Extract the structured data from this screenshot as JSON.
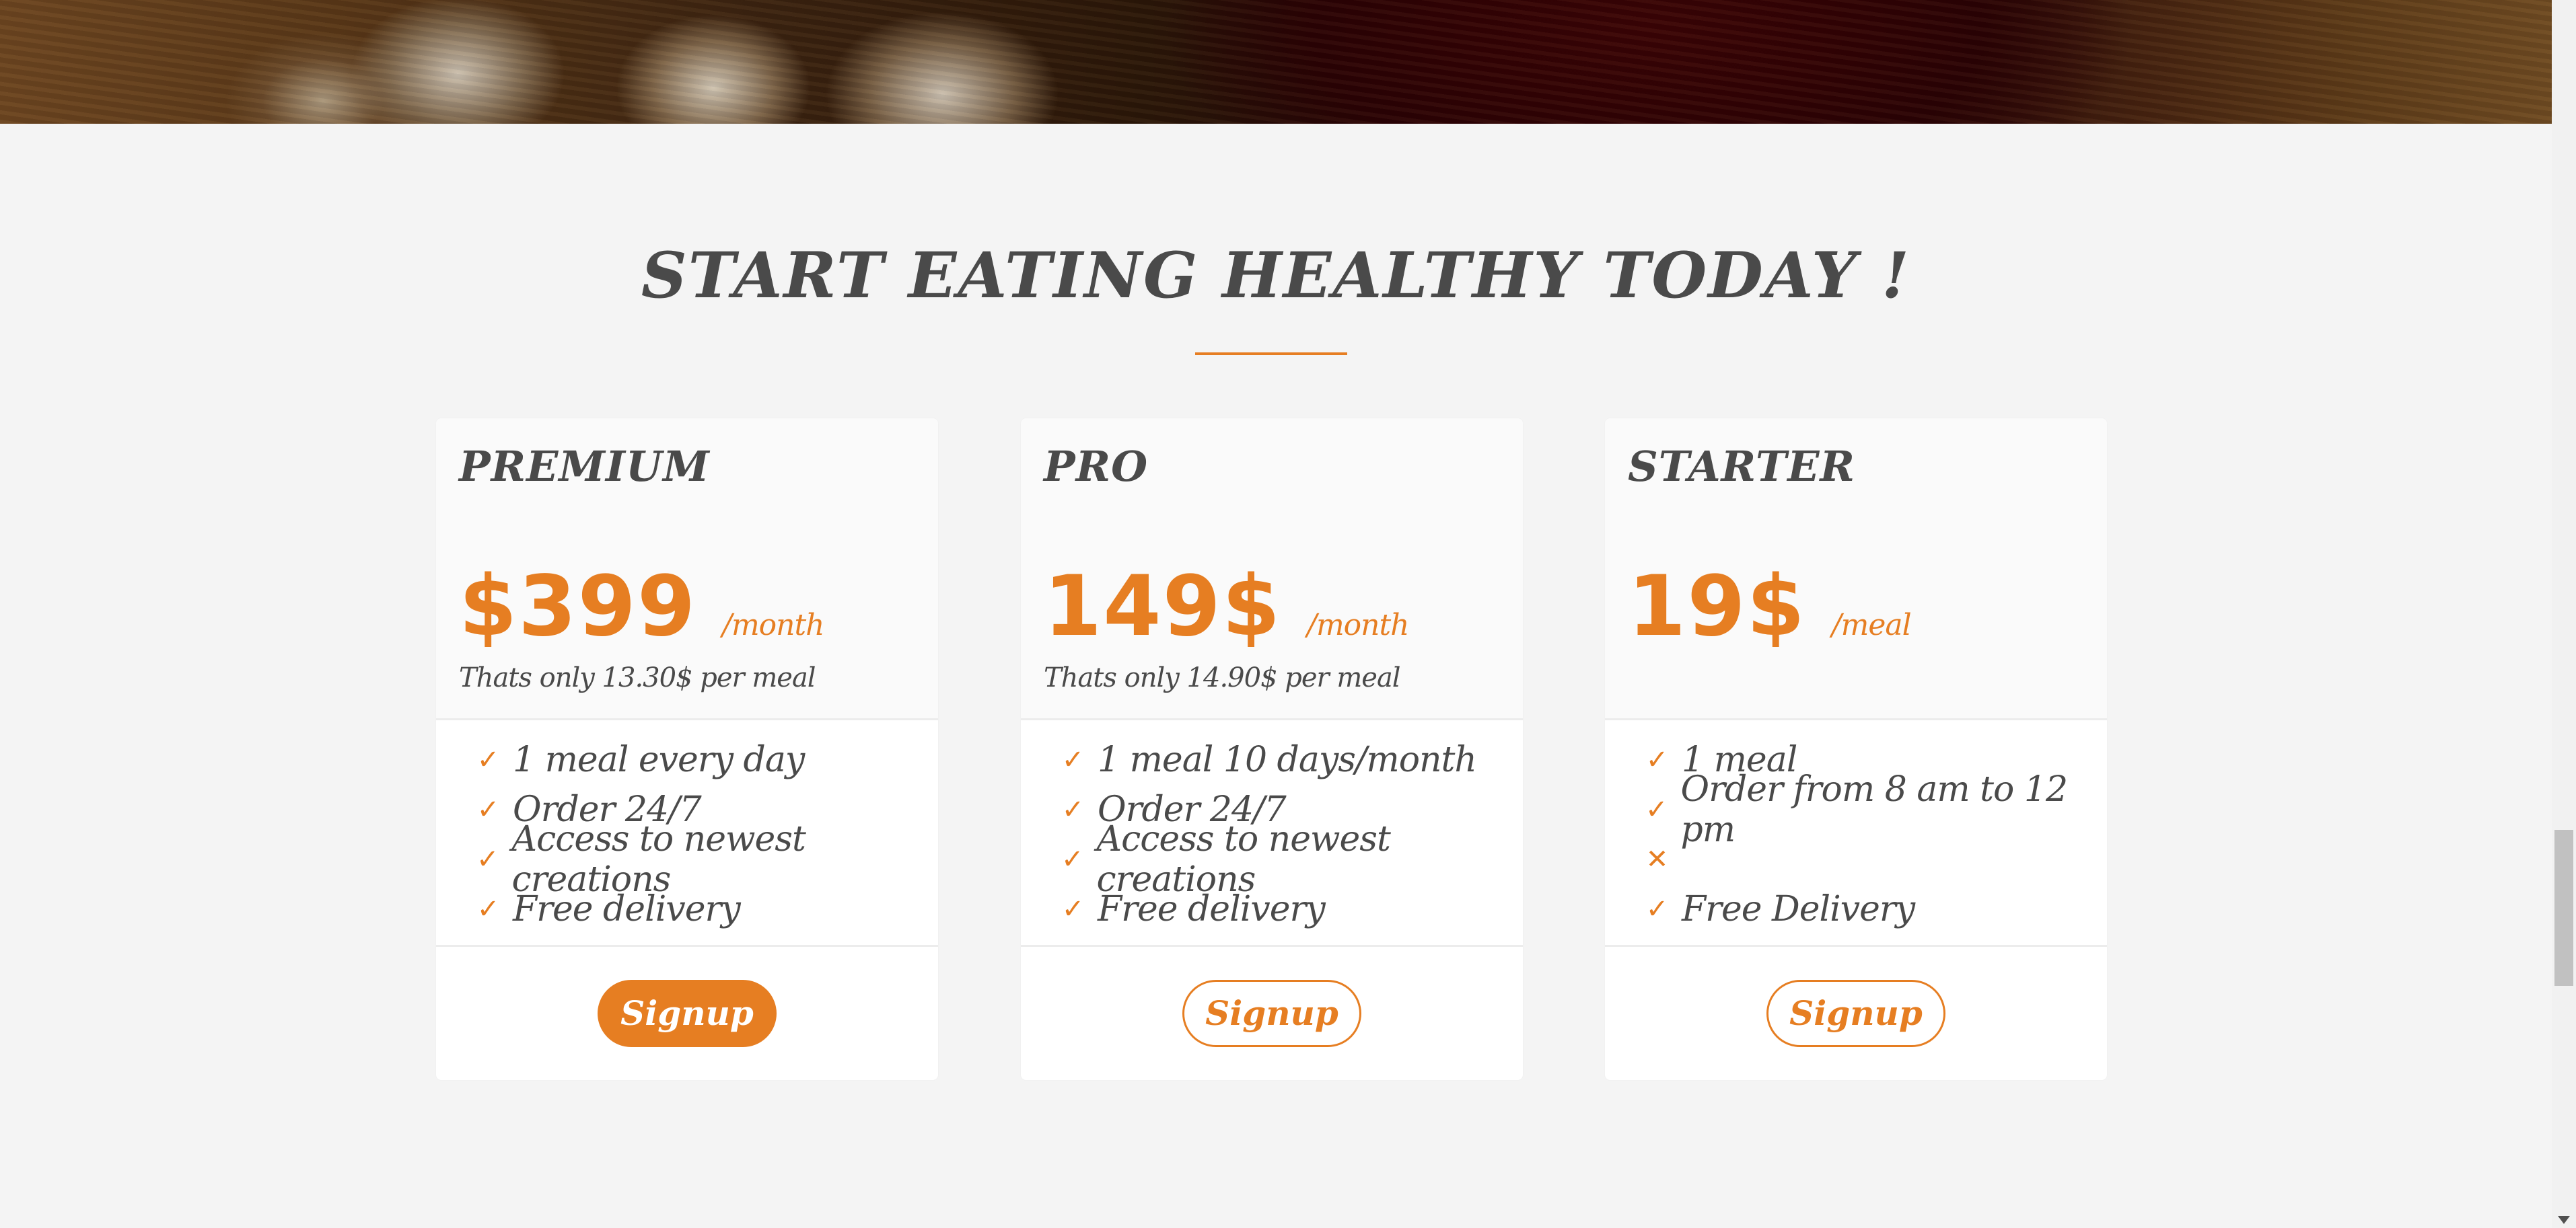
{
  "section": {
    "title": "START EATING HEALTHY TODAY !"
  },
  "plans": [
    {
      "name": "PREMIUM",
      "price": "$399",
      "period": "/month",
      "subtitle": "Thats only 13.30$ per meal",
      "features": [
        {
          "icon": "check-icon",
          "glyph": "✓",
          "text": "1 meal every day"
        },
        {
          "icon": "check-icon",
          "glyph": "✓",
          "text": "Order 24/7"
        },
        {
          "icon": "check-icon",
          "glyph": "✓",
          "text": "Access to newest creations"
        },
        {
          "icon": "check-icon",
          "glyph": "✓",
          "text": "Free delivery"
        }
      ],
      "button": "Signup"
    },
    {
      "name": "PRO",
      "price": "149$",
      "period": "/month",
      "subtitle": "Thats only 14.90$ per meal",
      "features": [
        {
          "icon": "check-icon",
          "glyph": "✓",
          "text": "1 meal 10 days/month"
        },
        {
          "icon": "check-icon",
          "glyph": "✓",
          "text": "Order 24/7"
        },
        {
          "icon": "check-icon",
          "glyph": "✓",
          "text": "Access to newest creations"
        },
        {
          "icon": "check-icon",
          "glyph": "✓",
          "text": "Free delivery"
        }
      ],
      "button": "Signup"
    },
    {
      "name": "STARTER",
      "price": "19$",
      "period": "/meal",
      "subtitle": "",
      "features": [
        {
          "icon": "check-icon",
          "glyph": "✓",
          "text": "1 meal"
        },
        {
          "icon": "check-icon",
          "glyph": "✓",
          "text": "Order from 8 am to 12 pm"
        },
        {
          "icon": "close-icon",
          "glyph": "✕",
          "text": ""
        },
        {
          "icon": "check-icon",
          "glyph": "✓",
          "text": "Free Delivery"
        }
      ],
      "button": "Signup"
    }
  ],
  "colors": {
    "accent": "#e67e22",
    "text": "#4a4a4a",
    "background": "#f4f4f4",
    "card": "#ffffff"
  }
}
